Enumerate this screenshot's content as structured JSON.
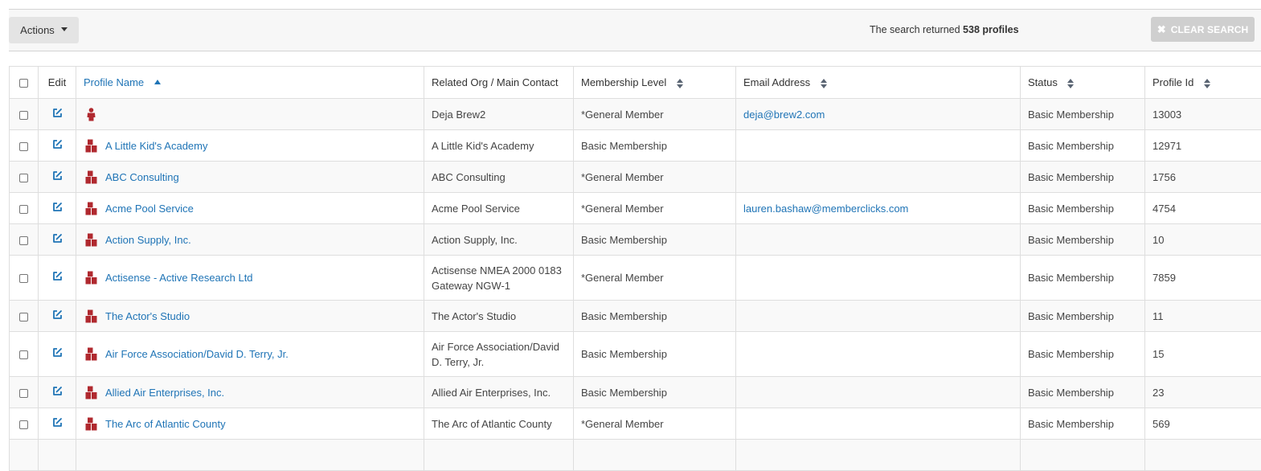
{
  "toolbar": {
    "actions_label": "Actions",
    "search_prefix": "The search returned",
    "search_count": "538 profiles",
    "clear_label": "CLEAR SEARCH"
  },
  "table": {
    "headers": {
      "edit": "Edit",
      "profile_name": "Profile Name",
      "related": "Related Org / Main Contact",
      "membership": "Membership Level",
      "email": "Email Address",
      "status": "Status",
      "profile_id": "Profile Id"
    },
    "rows": [
      {
        "type": "person",
        "name": "",
        "related": "Deja Brew2",
        "membership": "*General Member",
        "email": "deja@brew2.com",
        "status": "Basic Membership",
        "id": "13003"
      },
      {
        "type": "org",
        "name": "A Little Kid's Academy",
        "related": "A Little Kid's Academy",
        "membership": "Basic Membership",
        "email": "",
        "status": "Basic Membership",
        "id": "12971"
      },
      {
        "type": "org",
        "name": "ABC Consulting",
        "related": "ABC Consulting",
        "membership": "*General Member",
        "email": "",
        "status": "Basic Membership",
        "id": "1756"
      },
      {
        "type": "org",
        "name": "Acme Pool Service",
        "related": "Acme Pool Service",
        "membership": "*General Member",
        "email": "lauren.bashaw@memberclicks.com",
        "status": "Basic Membership",
        "id": "4754"
      },
      {
        "type": "org",
        "name": "Action Supply, Inc.",
        "related": "Action Supply, Inc.",
        "membership": "Basic Membership",
        "email": "",
        "status": "Basic Membership",
        "id": "10"
      },
      {
        "type": "org",
        "name": "Actisense - Active Research Ltd",
        "related": "Actisense NMEA 2000 0183 Gateway NGW-1",
        "membership": "*General Member",
        "email": "",
        "status": "Basic Membership",
        "id": "7859"
      },
      {
        "type": "org",
        "name": "The Actor's Studio",
        "related": "The Actor's Studio",
        "membership": "Basic Membership",
        "email": "",
        "status": "Basic Membership",
        "id": "11"
      },
      {
        "type": "org",
        "name": "Air Force Association/David D. Terry, Jr.",
        "related": "Air Force Association/David D. Terry, Jr.",
        "membership": "Basic Membership",
        "email": "",
        "status": "Basic Membership",
        "id": "15"
      },
      {
        "type": "org",
        "name": "Allied Air Enterprises, Inc.",
        "related": "Allied Air Enterprises, Inc.",
        "membership": "Basic Membership",
        "email": "",
        "status": "Basic Membership",
        "id": "23"
      },
      {
        "type": "org",
        "name": "The Arc of Atlantic County",
        "related": "The Arc of Atlantic County",
        "membership": "*General Member",
        "email": "",
        "status": "Basic Membership",
        "id": "569"
      },
      {
        "type": "org",
        "name": "",
        "related": "",
        "membership": "",
        "email": "",
        "status": "",
        "id": ""
      }
    ]
  },
  "colors": {
    "link": "#1f74b6",
    "profile_icon": "#b0292f",
    "clear_button_bg": "#cfcfcf"
  },
  "icons": {
    "edit": "edit-square-icon",
    "person": "person-icon",
    "org": "organization-blocks-icon",
    "sort_asc": "sort-ascending-icon",
    "sort_both": "sort-both-icon"
  }
}
